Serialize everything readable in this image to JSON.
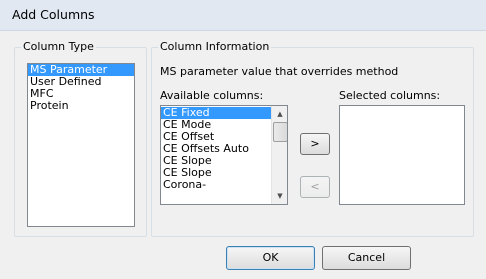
{
  "dialog": {
    "title": "Add Columns"
  },
  "column_type": {
    "legend": "Column Type",
    "items": [
      {
        "label": "MS Parameter",
        "selected": true
      },
      {
        "label": "User Defined",
        "selected": false
      },
      {
        "label": "MFC",
        "selected": false
      },
      {
        "label": "Protein",
        "selected": false
      }
    ]
  },
  "column_info": {
    "legend": "Column Information",
    "description": "MS parameter value that overrides method",
    "available_label": "Available columns:",
    "selected_label": "Selected columns:",
    "available_items": [
      {
        "label": "CE Fixed",
        "selected": true
      },
      {
        "label": "CE Mode",
        "selected": false
      },
      {
        "label": "CE Offset",
        "selected": false
      },
      {
        "label": "CE Offsets Auto",
        "selected": false
      },
      {
        "label": "CE Slope",
        "selected": false
      },
      {
        "label": "CE Slope",
        "selected": false
      },
      {
        "label": "Corona-",
        "selected": false
      }
    ],
    "selected_items": [],
    "add_button": ">",
    "remove_button": "<"
  },
  "buttons": {
    "ok": "OK",
    "cancel": "Cancel"
  },
  "icons": {
    "scroll_up": "scroll-up-arrow-icon",
    "scroll_down": "scroll-down-arrow-icon"
  }
}
